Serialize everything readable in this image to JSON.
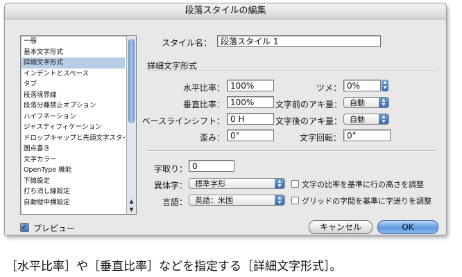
{
  "window": {
    "title": "段落スタイルの編集"
  },
  "sidebar": {
    "items": [
      {
        "label": "一般",
        "selected": false
      },
      {
        "label": "基本文字形式",
        "selected": false
      },
      {
        "label": "詳細文字形式",
        "selected": true
      },
      {
        "label": "インデントとスペース",
        "selected": false
      },
      {
        "label": "タブ",
        "selected": false
      },
      {
        "label": "段落境界線",
        "selected": false
      },
      {
        "label": "段落分離禁止オプション",
        "selected": false
      },
      {
        "label": "ハイフネーション",
        "selected": false
      },
      {
        "label": "ジャスティフィケーション",
        "selected": false
      },
      {
        "label": "ドロップキャップと先頭文字スタイル",
        "selected": false
      },
      {
        "label": "圏点書き",
        "selected": false
      },
      {
        "label": "文字カラー",
        "selected": false
      },
      {
        "label": "OpenType 機能",
        "selected": false
      },
      {
        "label": "下線設定",
        "selected": false
      },
      {
        "label": "打ち消し線設定",
        "selected": false
      },
      {
        "label": "自動縦中横設定",
        "selected": false
      }
    ]
  },
  "style_name": {
    "label": "スタイル名：",
    "value": "段落スタイル 1"
  },
  "section": {
    "title": "詳細文字形式"
  },
  "fields": {
    "horizontal_scale": {
      "label": "水平比率：",
      "value": "100%"
    },
    "vertical_scale": {
      "label": "垂直比率：",
      "value": "100%"
    },
    "baseline_shift": {
      "label": "ベースラインシフト：",
      "value": "0 H"
    },
    "skew": {
      "label": "歪み：",
      "value": "0°"
    },
    "tsume": {
      "label": "ツメ：",
      "value": "0%"
    },
    "aki_before": {
      "label": "文字前のアキ量：",
      "value": "自動"
    },
    "aki_after": {
      "label": "文字後のアキ量：",
      "value": "自動"
    },
    "rotation": {
      "label": "文字回転：",
      "value": "0°"
    },
    "mojikumi": {
      "label": "字取り：",
      "value": "0"
    },
    "alternate": {
      "label": "異体字：",
      "value": "標準字形"
    },
    "language": {
      "label": "言語：",
      "value": "英語：米国"
    }
  },
  "checkboxes": {
    "ratio_line_height": {
      "label": "文字の比率を基準に行の高さを調整",
      "checked": false
    },
    "grid_align": {
      "label": "グリッドの字間を基準に字送りを調整",
      "checked": false
    },
    "preview": {
      "label": "プレビュー",
      "checked": true
    }
  },
  "buttons": {
    "cancel": "キャンセル",
    "ok": "OK"
  },
  "caption": "［水平比率］や［垂直比率］などを指定する［詳細文字形式］。"
}
